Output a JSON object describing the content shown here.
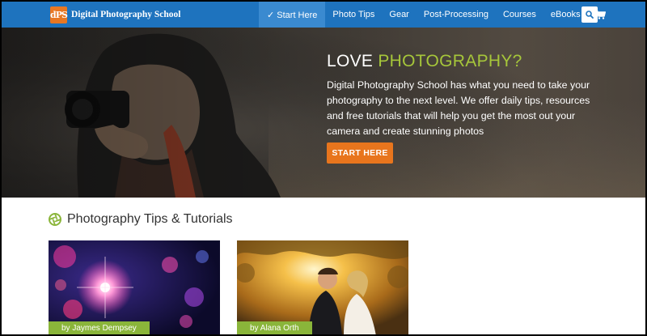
{
  "brand": {
    "logo_mark": "dPS",
    "name": "Digital Photography School"
  },
  "nav": {
    "items": [
      {
        "label": "✓ Start Here",
        "active": true
      },
      {
        "label": "Photo Tips"
      },
      {
        "label": "Gear"
      },
      {
        "label": "Post-Processing"
      },
      {
        "label": "Courses"
      },
      {
        "label": "eBooks"
      }
    ],
    "cart_icon": "cart-icon",
    "search_icon": "search-icon"
  },
  "hero": {
    "title_prefix": "LOVE ",
    "title_accent": "PHOTOGRAPHY?",
    "text": "Digital Photography School has what you need to take your photography to the next level. We offer daily tips, resources and free tutorials that will help you get the most out your camera and create stunning photos",
    "cta_label": "START HERE"
  },
  "section": {
    "icon": "aperture-icon",
    "title": "Photography Tips & Tutorials"
  },
  "cards": [
    {
      "byline": "by Jaymes Dempsey"
    },
    {
      "byline": "by Alana Orth"
    }
  ],
  "colors": {
    "nav_bg": "#1e73be",
    "nav_active": "#3a8ad0",
    "accent_green": "#a6c63a",
    "cta_orange": "#e8751d",
    "byline_green": "#8ab53a"
  }
}
